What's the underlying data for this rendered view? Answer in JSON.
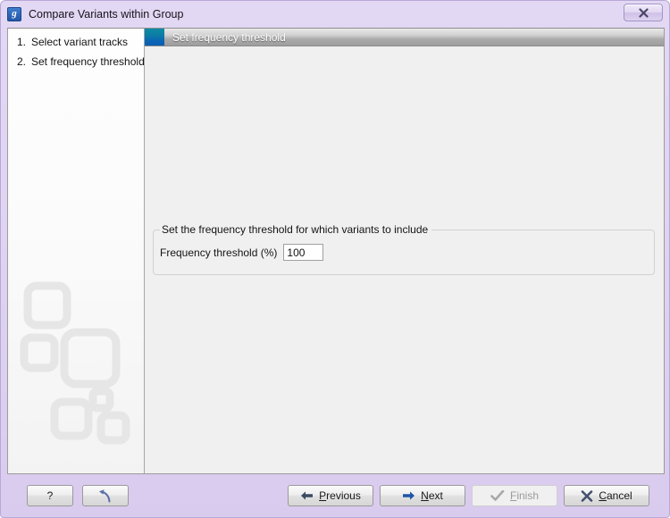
{
  "window": {
    "title": "Compare Variants within Group",
    "app_icon": "app-logo-icon",
    "close_label": "x"
  },
  "sidebar": {
    "steps": [
      {
        "num": "1.",
        "label": "Select variant tracks"
      },
      {
        "num": "2.",
        "label": "Set frequency threshold"
      }
    ]
  },
  "content": {
    "header_title": "Set frequency threshold",
    "group": {
      "legend": "Set the frequency threshold for which variants to include",
      "field_label": "Frequency threshold (%)",
      "field_value": "100",
      "field_placeholder": ""
    }
  },
  "footer": {
    "help_label": "?",
    "reset_label": "",
    "previous_label": "Previous",
    "previous_mnemonic": "P",
    "next_label": "Next",
    "next_mnemonic": "N",
    "finish_label": "Finish",
    "finish_mnemonic": "F",
    "finish_enabled": false,
    "cancel_label": "Cancel",
    "cancel_mnemonic": "C"
  },
  "colors": {
    "titlebar": "#ded2f0",
    "header_icon": "#0d7fa3",
    "accent_blue": "#2f66b8",
    "content_bg": "#f0f0f0"
  }
}
